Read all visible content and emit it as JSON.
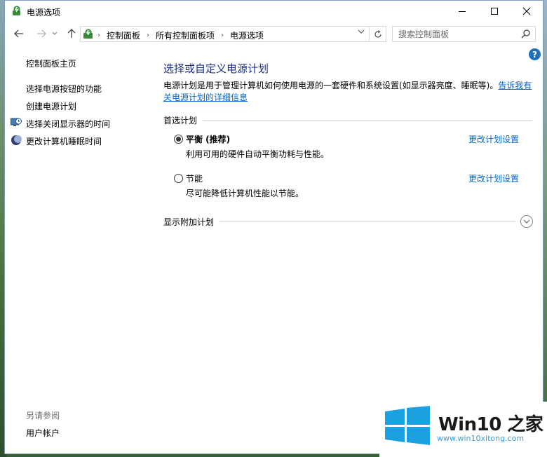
{
  "window": {
    "title": "电源选项"
  },
  "nav": {
    "breadcrumbs": [
      "控制面板",
      "所有控制面板项",
      "电源选项"
    ],
    "search_placeholder": "搜索控制面板"
  },
  "sidebar": {
    "items": [
      {
        "label": "控制面板主页",
        "icon": null
      },
      {
        "label": "选择电源按钮的功能",
        "icon": null
      },
      {
        "label": "创建电源计划",
        "icon": null
      },
      {
        "label": "选择关闭显示器的时间",
        "icon": "monitor-clock-icon"
      },
      {
        "label": "更改计算机睡眠时间",
        "icon": "moon-icon"
      }
    ],
    "see_also_heading": "另请参阅",
    "see_also_items": [
      {
        "label": "用户帐户"
      }
    ]
  },
  "main": {
    "heading": "选择或自定义电源计划",
    "intro_text": "电源计划是用于管理计算机如何使用电源的一套硬件和系统设置(如显示器亮度、睡眠等)。",
    "intro_link": "告诉我有关电源计划的详细信息",
    "preferred_section": "首选计划",
    "plans": [
      {
        "name": "平衡 (推荐)",
        "description": "利用可用的硬件自动平衡功耗与性能。",
        "change_label": "更改计划设置",
        "selected": true
      },
      {
        "name": "节能",
        "description": "尽可能降低计算机性能以节能。",
        "change_label": "更改计划设置",
        "selected": false
      }
    ],
    "additional_section": "显示附加计划"
  },
  "watermark": {
    "brand": "Win10 之家",
    "url": "www.win10xitong.com"
  },
  "colors": {
    "heading_blue": "#1e3287",
    "link_blue": "#0066cc",
    "win_logo_blue": "#1ba1e2"
  }
}
